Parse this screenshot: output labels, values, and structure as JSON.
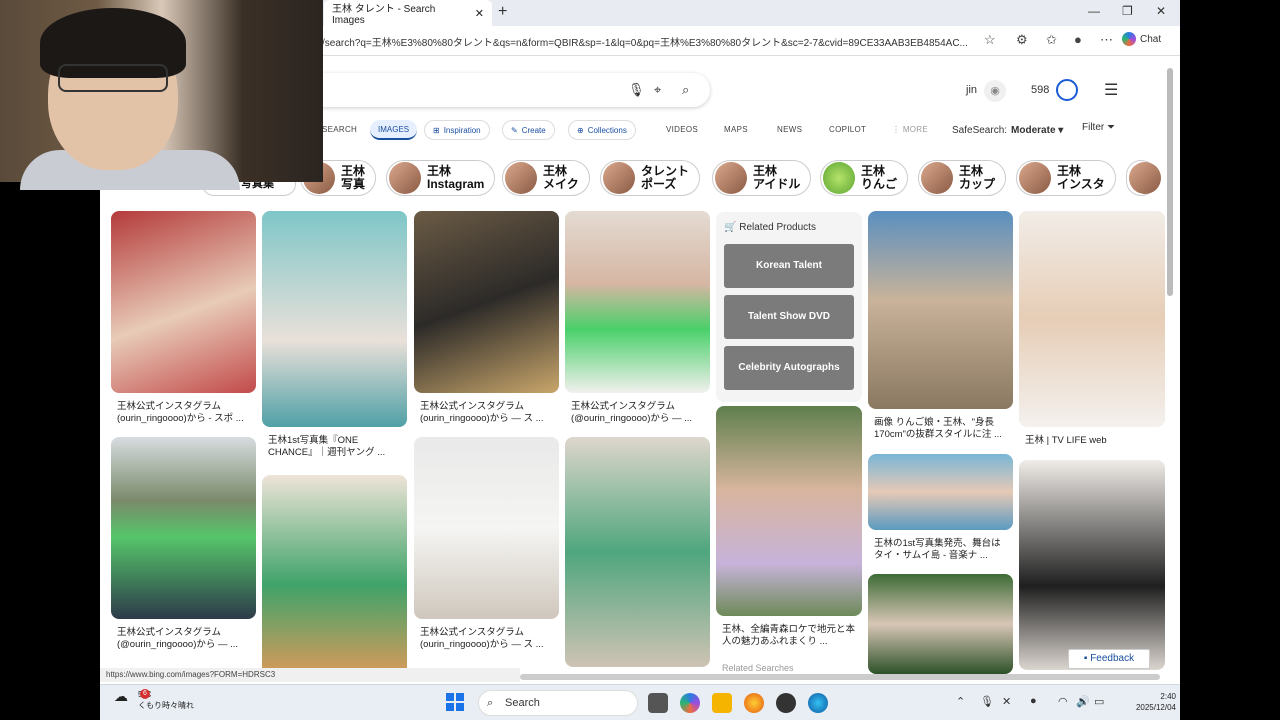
{
  "tab": {
    "title": "王林 タレント - Search Images",
    "close": "✕",
    "new": "+"
  },
  "window": {
    "minimize": "—",
    "restore": "❐",
    "close": "✕"
  },
  "address": {
    "url": "/search?q=王林%E3%80%80タレント&qs=n&form=QBIR&sp=-1&lq=0&pq=王林%E3%80%80タレント&sc=2-7&cvid=89CE33AAB3EB4854AC..."
  },
  "browser": {
    "chat_label": "Chat"
  },
  "header": {
    "user": "jin",
    "points": "598"
  },
  "nav": {
    "search": "SEARCH",
    "images": "IMAGES",
    "inspiration": "Inspiration",
    "create": "Create",
    "collections": "Collections",
    "videos": "VIDEOS",
    "maps": "MAPS",
    "news": "NEWS",
    "copilot": "COPILOT",
    "more": "⋮ MORE",
    "safesearch_label": "SafeSearch:",
    "safesearch_value": "Moderate ▾",
    "filter": "Filter"
  },
  "chips": [
    {
      "l1": "王林",
      "l2": "写真"
    },
    {
      "l1": "王林",
      "l2": "Instagram"
    },
    {
      "l1": "王林",
      "l2": "メイク"
    },
    {
      "l1": "タレント",
      "l2": "ポーズ"
    },
    {
      "l1": "王林",
      "l2": "アイドル"
    },
    {
      "l1": "王林",
      "l2": "りんご"
    },
    {
      "l1": "王林",
      "l2": "カップ"
    },
    {
      "l1": "王林",
      "l2": "インスタ"
    }
  ],
  "chips_partial": "写真集",
  "cards": {
    "c1": "王林公式インスタグラム (ourin_ringoooo)から - スポ ...",
    "c2": "王林1st写真集『ONE CHANCE』｜週刊ヤング ...",
    "c3": "王林公式インスタグラム (ourin_ringoooo)から — ス ...",
    "c4": "王林公式インスタグラム (@ourin_ringoooo)から — ...",
    "c5": "画像 りんご娘・王林、\"身長170cm\"の抜群スタイルに注 ...",
    "c6": "王林 | TV LIFE web",
    "c7": "王林公式インスタグラム (@ourin_ringoooo)から — ...",
    "c8": "王林公式インスタグラム (ourin_ringoooo)から — ス ...",
    "c9": "王林、全編青森ロケで地元と本人の魅力あふれまくり ...",
    "c10": "王林の1st写真集発売、舞台はタイ・サムイ島 - 音楽ナ ..."
  },
  "related": {
    "header": "Related Products",
    "items": [
      "Korean Talent",
      "Talent Show DVD",
      "Celebrity Autographs"
    ]
  },
  "related_searches_partial": "Related Searches",
  "statusbar": {
    "url": "https://www.bing.com/images?FORM=HDRSC3"
  },
  "feedback": "Feedback",
  "taskbar": {
    "weather_badge": "6",
    "weather_temp": "5°C",
    "weather_desc": "くもり時々晴れ",
    "search": "Search",
    "time": "2:40",
    "date": "2025/12/04"
  }
}
